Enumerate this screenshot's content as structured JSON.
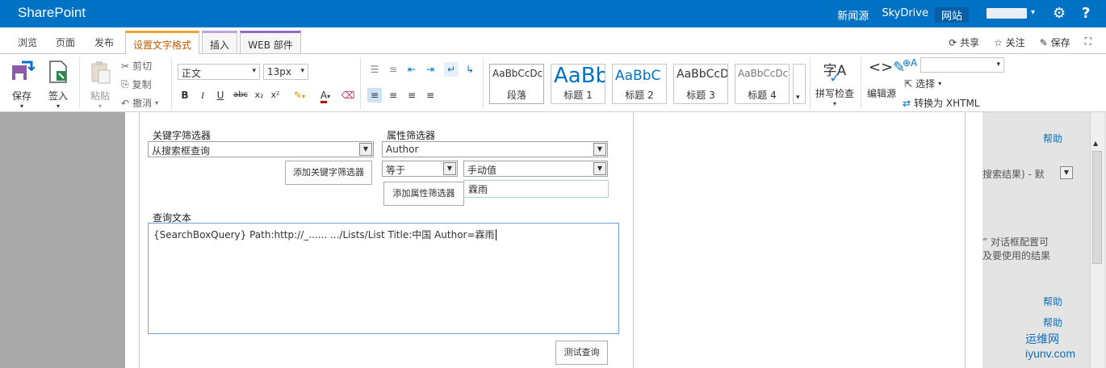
{
  "suite": {
    "brand": "SharePoint",
    "links": [
      "新闻源",
      "SkyDrive",
      "网站"
    ],
    "gear": "⚙",
    "help": "?"
  },
  "tabs": {
    "browse": "浏览",
    "page": "页面",
    "publish": "发布",
    "format_text": "设置文字格式",
    "insert": "插入",
    "web_part": "WEB 部件",
    "share": "共享",
    "follow": "关注",
    "save": "保存"
  },
  "ribbon": {
    "save": "保存",
    "checkin": "签入",
    "paste": "粘贴",
    "cut": "剪切",
    "copy": "复制",
    "undo": "撤消",
    "style_select": "正文",
    "size_select": "13px",
    "bold": "B",
    "italic": "I",
    "underline": "U",
    "strike": "abc",
    "subscript": "x₂",
    "superscript": "x²",
    "styles": [
      {
        "sample": "AaBbCcDc",
        "caption": "段落"
      },
      {
        "sample": "AaBb",
        "caption": "标题 1"
      },
      {
        "sample": "AaBbC",
        "caption": "标题 2"
      },
      {
        "sample": "AaBbCcD",
        "caption": "标题 3"
      },
      {
        "sample": "AaBbCcDc",
        "caption": "标题 4"
      }
    ],
    "spellcheck": "拼写检查",
    "spell_icon_text": "字A",
    "edit_source": "编辑源",
    "select": "选择",
    "convert_xhtml": "转换为 XHTML",
    "html_icon": "<>"
  },
  "form": {
    "keyword_filter_label": "关键字筛选器",
    "keyword_filter_value": "从搜索框查询",
    "add_keyword_filter": "添加关键字筛选器",
    "property_filter_label": "属性筛选器",
    "property_value": "Author",
    "operator_value": "等于",
    "manual_value": "手动值",
    "add_property_filter": "添加属性筛选器",
    "property_input": "霖雨",
    "query_text_label": "查询文本",
    "query_text_value": "{SearchBoxQuery} Path:http://_...... .../Lists/List Title:中国 Author=霖雨",
    "test_query": "测试查询"
  },
  "rightpage": {
    "help1": "帮助",
    "partial_select": "搜索结果) - 默",
    "desc_line1": "” 对话框配置可",
    "desc_line2": "及要使用的结果",
    "help2": "帮助",
    "help3": "帮助"
  },
  "watermark": "运维网 iyunv.com"
}
